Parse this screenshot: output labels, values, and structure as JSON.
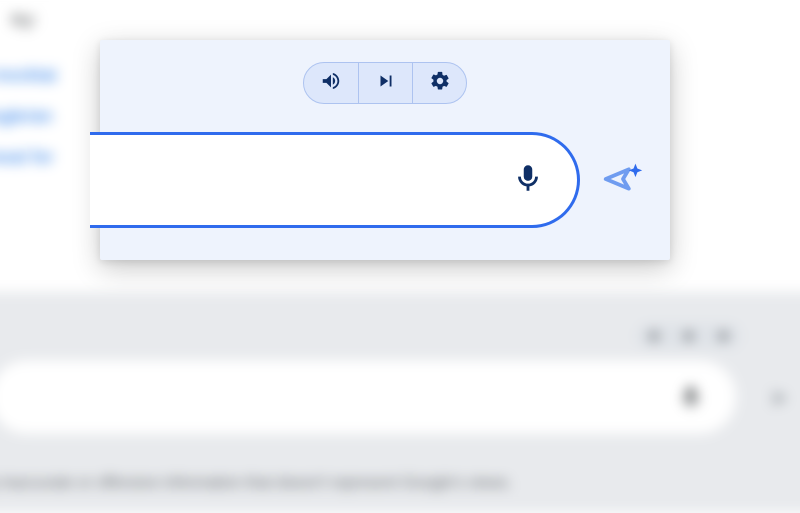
{
  "background": {
    "try_label": "try:",
    "suggestion_links": [
      "er mocktai",
      "google/an",
      "n meal for"
    ],
    "disclaimer": "ay inaccurate or offensive information that doesn't represent Google's views."
  },
  "card": {
    "controls": {
      "volume": "volume-icon",
      "skip": "skip-next-icon",
      "settings": "gear-icon"
    },
    "mic": "microphone-icon",
    "send": "send-sparkle-icon"
  },
  "colors": {
    "card_bg": "#eef3fd",
    "input_border": "#2f6bed",
    "icon_dark": "#0f2f66",
    "send_stroke": "#6f9cf0"
  }
}
